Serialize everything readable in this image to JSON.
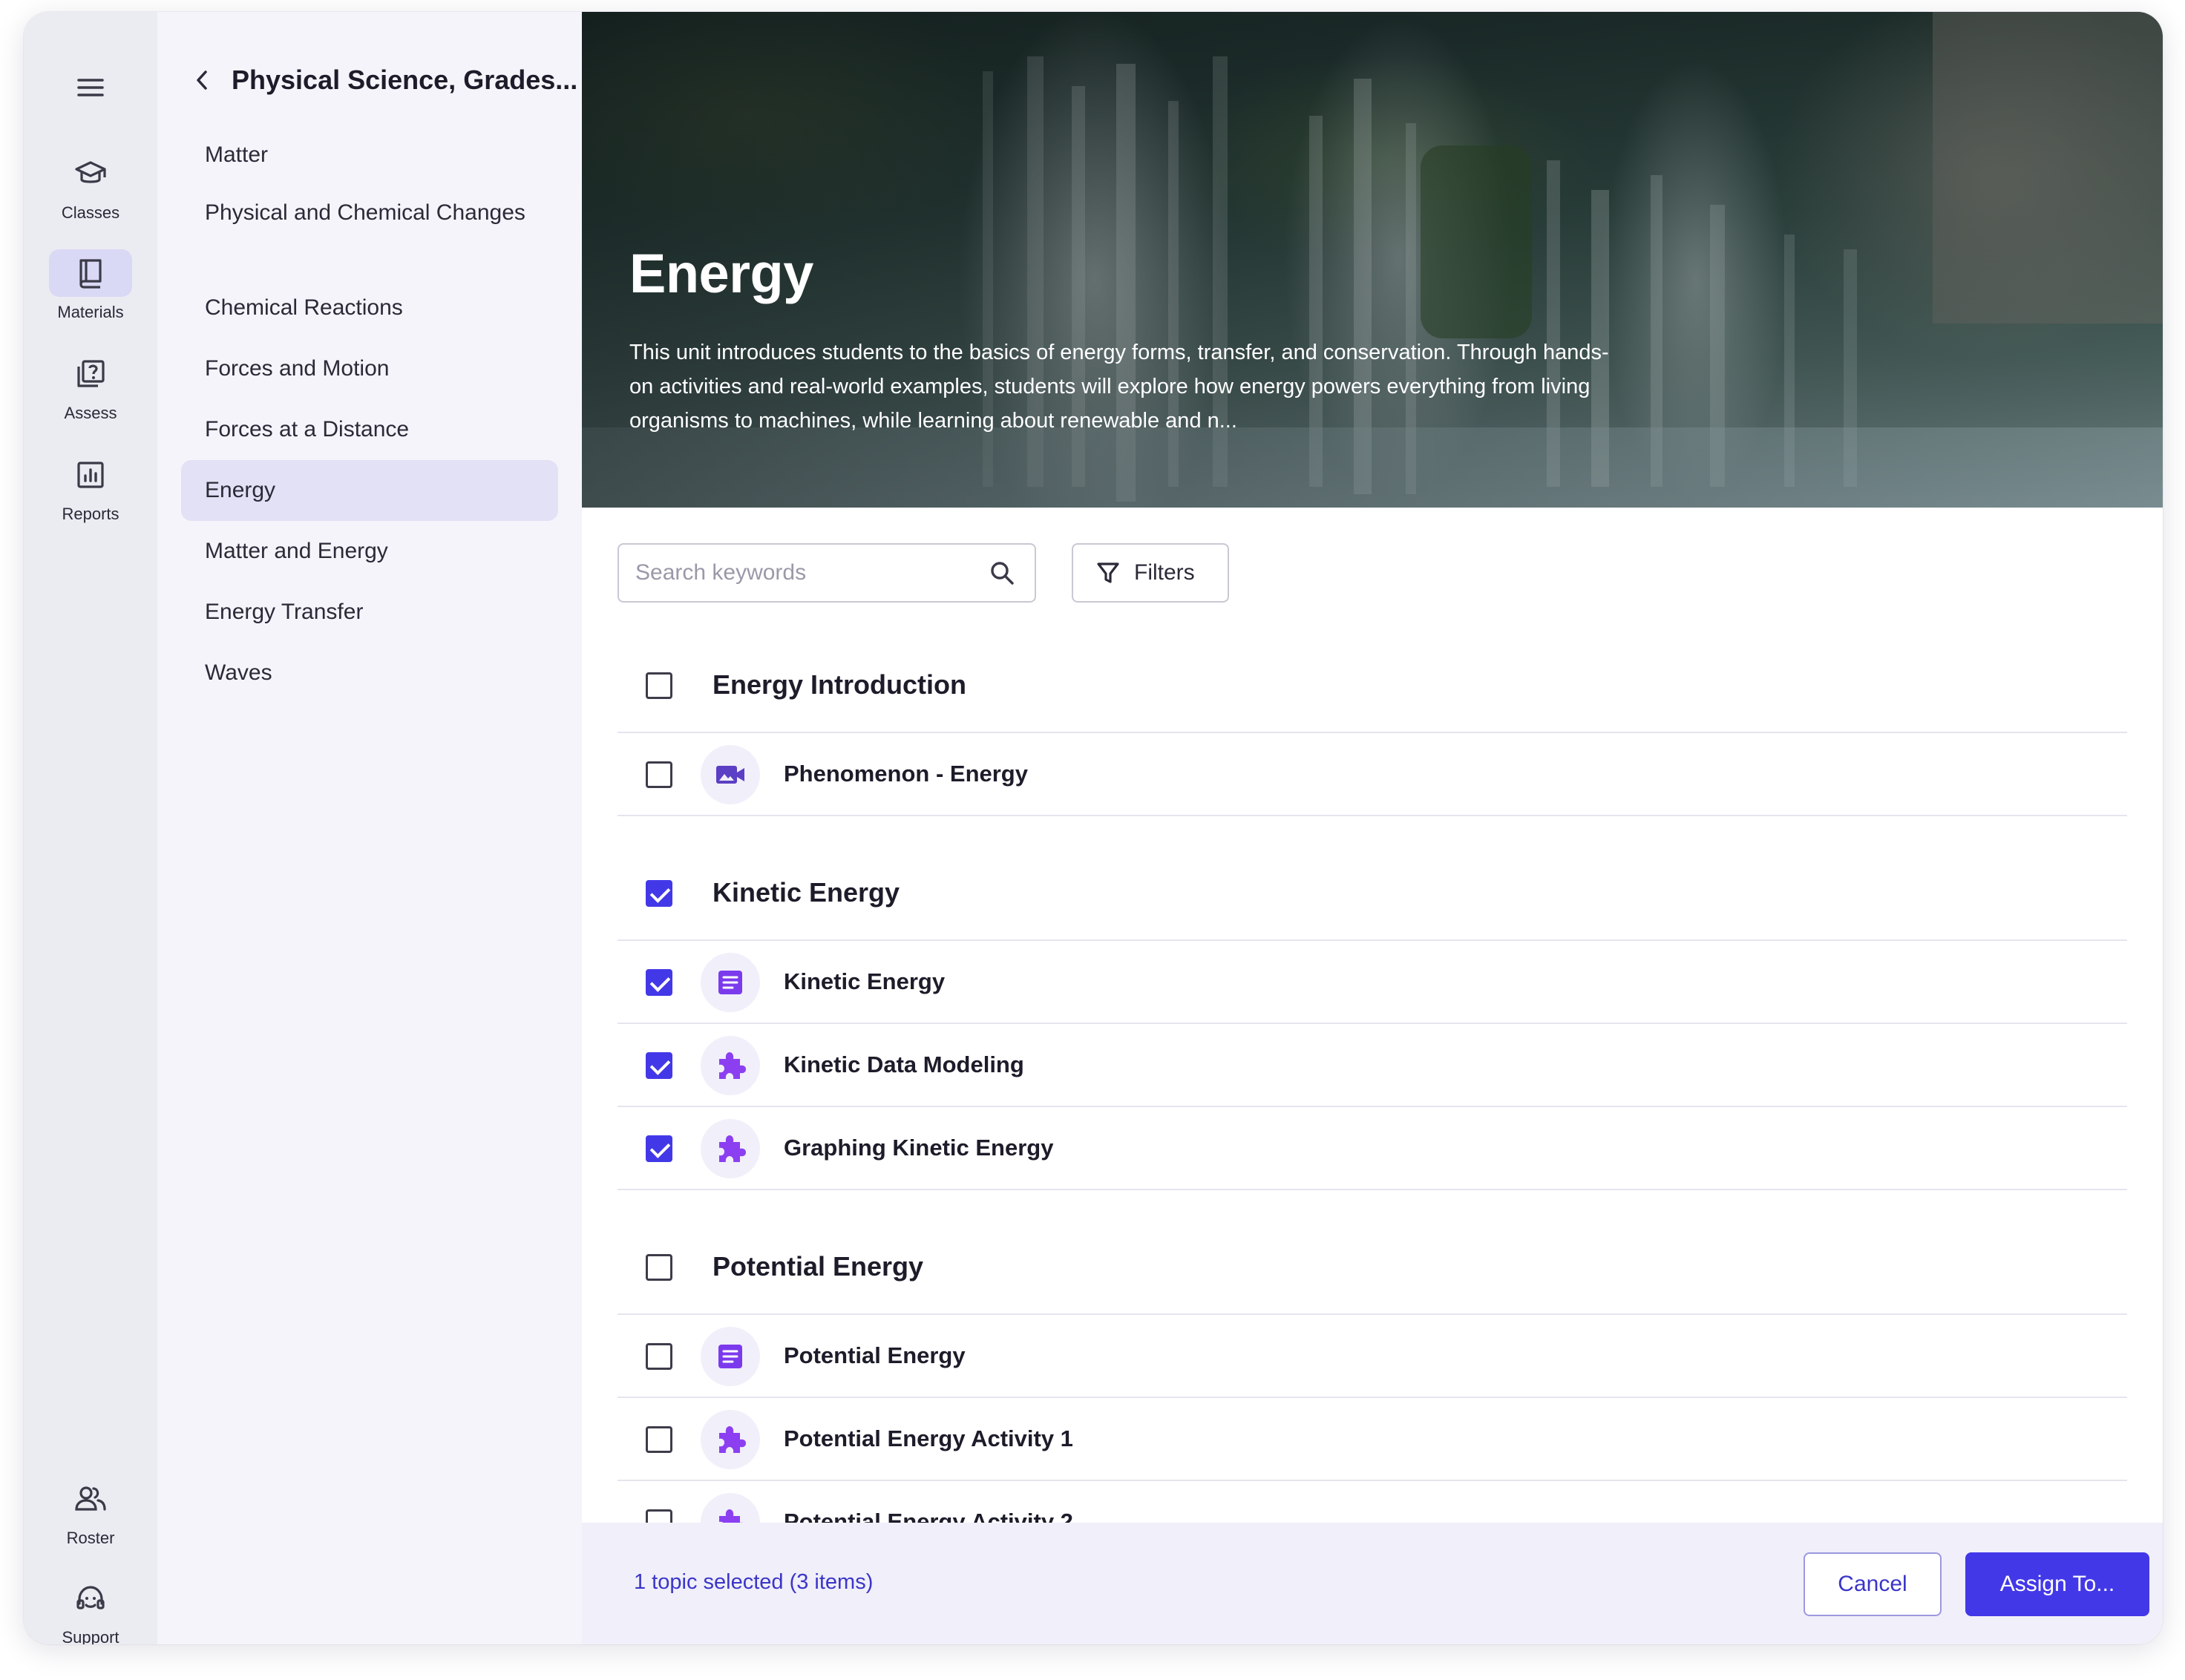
{
  "rail": {
    "menu_icon": "hamburger-menu-icon",
    "items": [
      {
        "label": "Classes",
        "icon": "graduation-cap-icon"
      },
      {
        "label": "Materials",
        "icon": "book-icon"
      },
      {
        "label": "Assess",
        "icon": "question-pages-icon"
      },
      {
        "label": "Reports",
        "icon": "bar-chart-icon"
      },
      {
        "label": "Roster",
        "icon": "people-icon"
      },
      {
        "label": "Support",
        "icon": "headset-icon"
      }
    ]
  },
  "nav": {
    "title": "Physical Science, Grades...",
    "items": [
      {
        "label": "Matter"
      },
      {
        "label": "Physical and Chemical Changes"
      },
      {
        "label": "Chemical Reactions"
      },
      {
        "label": "Forces and Motion"
      },
      {
        "label": "Forces at a Distance"
      },
      {
        "label": "Energy"
      },
      {
        "label": "Matter and Energy"
      },
      {
        "label": "Energy Transfer"
      },
      {
        "label": "Waves"
      }
    ],
    "active": "Energy"
  },
  "hero": {
    "title": "Energy",
    "description": "This unit introduces students to the basics of energy forms, transfer, and conservation. Through hands-on activities and real-world examples, students will explore how energy powers everything from living organisms to machines, while learning about renewable and n..."
  },
  "search": {
    "placeholder": "Search keywords",
    "value": ""
  },
  "filters": {
    "label": "Filters"
  },
  "groups": [
    {
      "title": "Energy Introduction",
      "checked": false,
      "items": [
        {
          "title": "Phenomenon - Energy",
          "type": "video-icon",
          "checked": false
        }
      ]
    },
    {
      "title": "Kinetic Energy",
      "checked": true,
      "items": [
        {
          "title": "Kinetic Energy",
          "type": "document-icon",
          "checked": true
        },
        {
          "title": "Kinetic Data Modeling",
          "type": "puzzle-icon",
          "checked": true
        },
        {
          "title": "Graphing Kinetic Energy",
          "type": "puzzle-icon",
          "checked": true
        }
      ]
    },
    {
      "title": "Potential Energy",
      "checked": false,
      "items": [
        {
          "title": "Potential Energy",
          "type": "document-icon",
          "checked": false
        },
        {
          "title": "Potential Energy Activity 1",
          "type": "puzzle-icon",
          "checked": false
        },
        {
          "title": "Potential Energy Activity 2",
          "type": "puzzle-icon",
          "checked": false
        }
      ]
    }
  ],
  "footer": {
    "status": "1 topic selected (3 items)",
    "cancel_label": "Cancel",
    "assign_label": "Assign To..."
  },
  "colors": {
    "accent": "#4338e8",
    "icon_purple": "#7c3aed",
    "video_purple": "#5b3fc4",
    "rail_bg": "#ebebf2",
    "nav_bg": "#f5f4fa",
    "nav_active": "#e2e1f5"
  }
}
